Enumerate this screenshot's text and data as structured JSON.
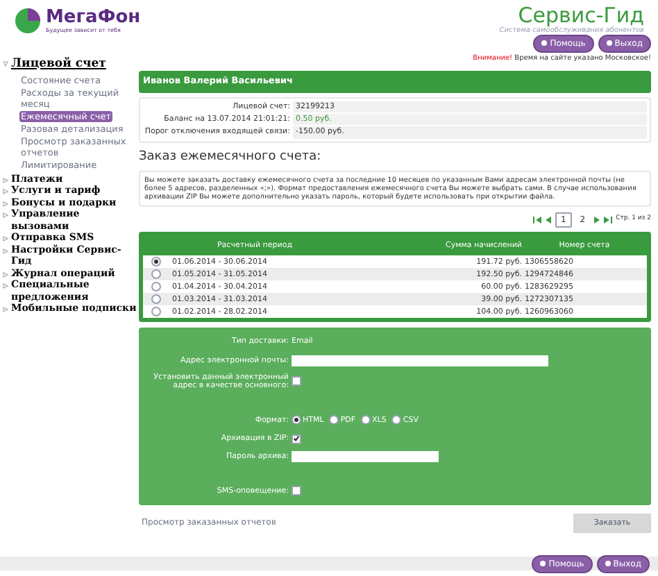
{
  "logo": {
    "name": "МегаФон",
    "tagline": "Будущее зависит от тебя"
  },
  "service": {
    "title": "Сервис-Гид",
    "subtitle": "Система самообслуживания абонентов"
  },
  "top_buttons": [
    "Помощь",
    "Выход"
  ],
  "notice": {
    "warning": "Внимание!",
    "text": "Время на сайте указано Московское!"
  },
  "sidebar": {
    "items": [
      {
        "label": "Лицевой счет",
        "expanded": true,
        "children": [
          {
            "label": "Состояние счета",
            "selected": false
          },
          {
            "label": "Расходы за текущий месяц",
            "selected": false
          },
          {
            "label": "Ежемесячный счет",
            "selected": true
          },
          {
            "label": "Разовая детализация",
            "selected": false
          },
          {
            "label": "Просмотр заказанных отчетов",
            "selected": false
          },
          {
            "label": "Лимитирование",
            "selected": false
          }
        ]
      },
      {
        "label": "Платежи",
        "expanded": false
      },
      {
        "label": "Услуги и тариф",
        "expanded": false
      },
      {
        "label": "Бонусы и подарки",
        "expanded": false
      },
      {
        "label": "Управление вызовами",
        "expanded": false
      },
      {
        "label": "Отправка SMS",
        "expanded": false
      },
      {
        "label": "Настройки Сервис-Гид",
        "expanded": false
      },
      {
        "label": "Журнал операций",
        "expanded": false
      },
      {
        "label": "Специальные предложения",
        "expanded": false
      },
      {
        "label": "Мобильные подписки",
        "expanded": false
      }
    ]
  },
  "customer": {
    "name": "Иванов Валерий Васильевич"
  },
  "account_info": [
    {
      "label": "Лицевой счет:",
      "value": "32199213",
      "kind": "plain"
    },
    {
      "label": "Баланс на 13.07.2014 21:01:21:",
      "value": "0.50 руб.",
      "kind": "positive"
    },
    {
      "label": "Порог отключения входящей связи:",
      "value": "-150.00 руб.",
      "kind": "plain"
    }
  ],
  "heading": "Заказ ежемесячного счета:",
  "description": "Вы можете заказать доставку ежемесячного счета за последние 10 месяцев по указанным Вами адресам электронной почты (не более 5 адресов, разделенных «;»). Формат предоставления ежемесячного счета Вы можете выбрать сами. В случае использования архивации ZIP Вы можете дополнительно указать пароль, который будете использовать при открытии файла.",
  "pagination": {
    "pages": [
      {
        "label": "1",
        "selected": true
      },
      {
        "label": "2",
        "selected": false
      }
    ],
    "info": "Стр. 1 из 2"
  },
  "table": {
    "columns": [
      "Расчетный период",
      "Сумма начислений",
      "Номер счета"
    ],
    "rows": [
      {
        "selected": true,
        "period": "01.06.2014 - 30.06.2014",
        "amount": "191.72 руб.",
        "number": "1306558620"
      },
      {
        "selected": false,
        "period": "01.05.2014 - 31.05.2014",
        "amount": "192.50 руб.",
        "number": "1294724846"
      },
      {
        "selected": false,
        "period": "01.04.2014 - 30.04.2014",
        "amount": "60.00 руб.",
        "number": "1283629295"
      },
      {
        "selected": false,
        "period": "01.03.2014 - 31.03.2014",
        "amount": "39.00 руб.",
        "number": "1272307135"
      },
      {
        "selected": false,
        "period": "01.02.2014 - 28.02.2014",
        "amount": "104.00 руб.",
        "number": "1260963060"
      }
    ]
  },
  "form": {
    "delivery_label": "Тип доставки:",
    "delivery_value": "Email",
    "email_label": "Адрес электронной почты:",
    "default_label": "Установить данный электронный адрес в качестве основного:",
    "default_checked": false,
    "format_label": "Формат:",
    "formats": [
      {
        "label": "HTML",
        "selected": true
      },
      {
        "label": "PDF",
        "selected": false
      },
      {
        "label": "XLS",
        "selected": false
      },
      {
        "label": "CSV",
        "selected": false
      }
    ],
    "zip_label": "Архивация в ZIP:",
    "zip_checked": true,
    "password_label": "Пароль архива:",
    "sms_label": "SMS-оповещение:",
    "sms_checked": false
  },
  "footer": {
    "link": "Просмотр заказанных отчетов",
    "order_button": "Заказать",
    "buttons": [
      "Помощь",
      "Выход"
    ]
  }
}
